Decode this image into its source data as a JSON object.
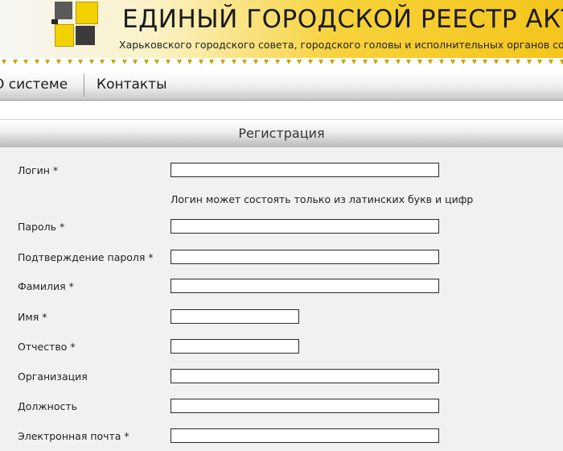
{
  "header": {
    "title": "ЕДИНЫЙ ГОРОДСКОЙ РЕЕСТР АКТОВ",
    "subtitle": "Харьковского городского совета, городского головы и исполнительных органов совета"
  },
  "nav": {
    "items": [
      {
        "label": "О системе"
      },
      {
        "label": "Контакты"
      }
    ]
  },
  "form": {
    "heading": "Регистрация",
    "login": {
      "label": "Логин *",
      "value": "",
      "hint": "Логин может состоять только из латинских букв и цифр"
    },
    "password": {
      "label": "Пароль *",
      "value": ""
    },
    "password_confirm": {
      "label": "Подтверждение пароля *",
      "value": ""
    },
    "last_name": {
      "label": "Фамилия *",
      "value": ""
    },
    "first_name": {
      "label": "Имя *",
      "value": ""
    },
    "patronymic": {
      "label": "Отчество *",
      "value": ""
    },
    "organization": {
      "label": "Организация",
      "value": ""
    },
    "position": {
      "label": "Должность",
      "value": ""
    },
    "email": {
      "label": "Электронная почта *",
      "value": ""
    }
  },
  "colors": {
    "brand_yellow": "#f2d200",
    "panel_bg": "#f1f1f1"
  }
}
